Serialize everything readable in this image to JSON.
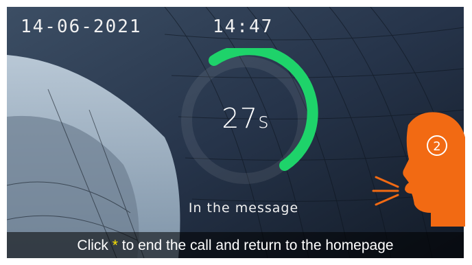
{
  "status": {
    "date": "14-06-2021",
    "time": "14:47"
  },
  "timer": {
    "value": "27",
    "unit": "s",
    "progress_fraction": 0.45,
    "color": "#1ed36a"
  },
  "message": {
    "label": "In the message"
  },
  "footer": {
    "prefix": "Click",
    "key": "*",
    "suffix": "to end the call and return to the homepage"
  },
  "callout": {
    "badge_number": "2",
    "icon": "speaking-head-icon",
    "color": "#f26a13"
  }
}
